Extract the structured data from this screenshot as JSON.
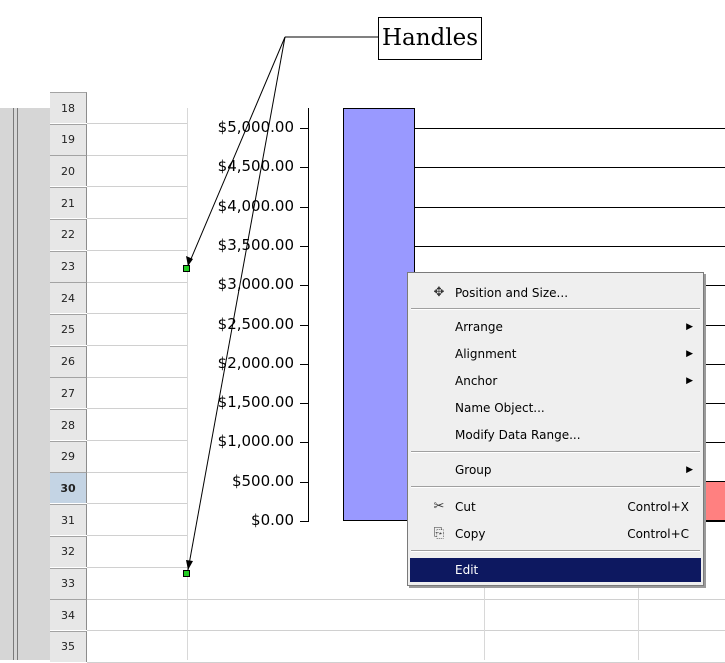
{
  "callout": {
    "text": "Handles"
  },
  "rows": [
    "18",
    "19",
    "20",
    "21",
    "22",
    "23",
    "24",
    "25",
    "26",
    "27",
    "28",
    "29",
    "30",
    "31",
    "32",
    "33",
    "34",
    "35"
  ],
  "active_row": "30",
  "chart": {
    "y_ticks": [
      "$5,000.00",
      "$4,500.00",
      "$4,000.00",
      "$3,500.00",
      "$3,000.00",
      "$2,500.00",
      "$2,000.00",
      "$1,500.00",
      "$1,000.00",
      "$500.00",
      "$0.00"
    ],
    "bar_color": "#9999ff",
    "second_bar_color": "#ff8080"
  },
  "context_menu": {
    "position_size": {
      "label": "Position and Size...",
      "icon": "position-size-icon"
    },
    "arrange": "Arrange",
    "alignment": "Alignment",
    "anchor": "Anchor",
    "name_object": "Name Object...",
    "modify_data_range": "Modify Data Range...",
    "group": "Group",
    "cut": {
      "label": "Cut",
      "shortcut": "Control+X",
      "icon": "scissors-icon"
    },
    "copy": {
      "label": "Copy",
      "shortcut": "Control+C",
      "icon": "copy-icon"
    },
    "edit": "Edit"
  },
  "colors": {
    "selection": "#0d1860",
    "handle": "#22cc22",
    "menu_bg": "#efefef"
  }
}
